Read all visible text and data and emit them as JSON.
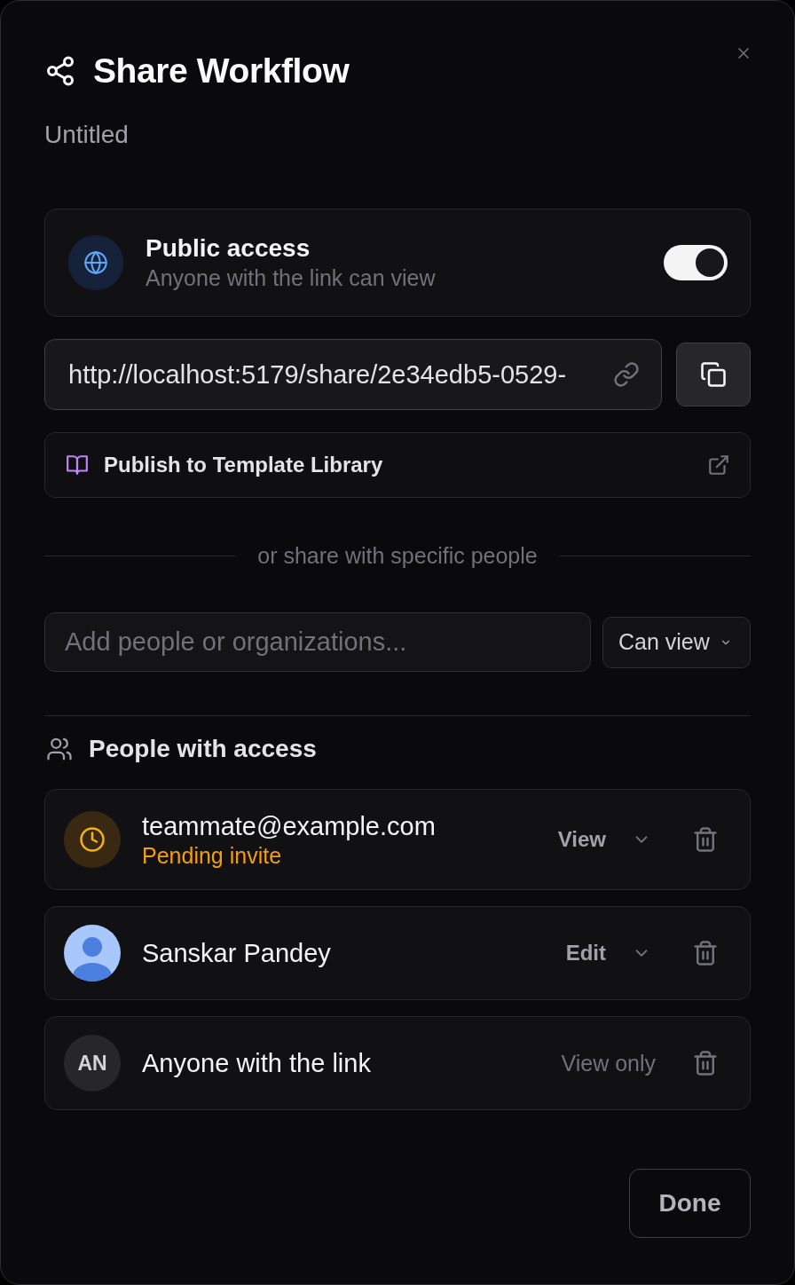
{
  "dialog": {
    "title": "Share Workflow",
    "subtitle": "Untitled"
  },
  "public_access": {
    "title": "Public access",
    "description": "Anyone with the link can view",
    "on": true
  },
  "share_link": {
    "value": "http://localhost:5179/share/2e34edb5-0529-"
  },
  "publish": {
    "label": "Publish to Template Library"
  },
  "divider": {
    "text": "or share with specific people"
  },
  "invite": {
    "placeholder": "Add people or organizations...",
    "role": "Can view"
  },
  "people": {
    "title": "People with access",
    "members": [
      {
        "kind": "pending",
        "name": "teammate@example.com",
        "status": "Pending invite",
        "role": "View"
      },
      {
        "kind": "user",
        "name": "Sanskar Pandey",
        "role": "Edit"
      },
      {
        "kind": "link",
        "initials": "AN",
        "name": "Anyone with the link",
        "role": "View only"
      }
    ]
  },
  "buttons": [
    {
      "label": "Done"
    }
  ]
}
